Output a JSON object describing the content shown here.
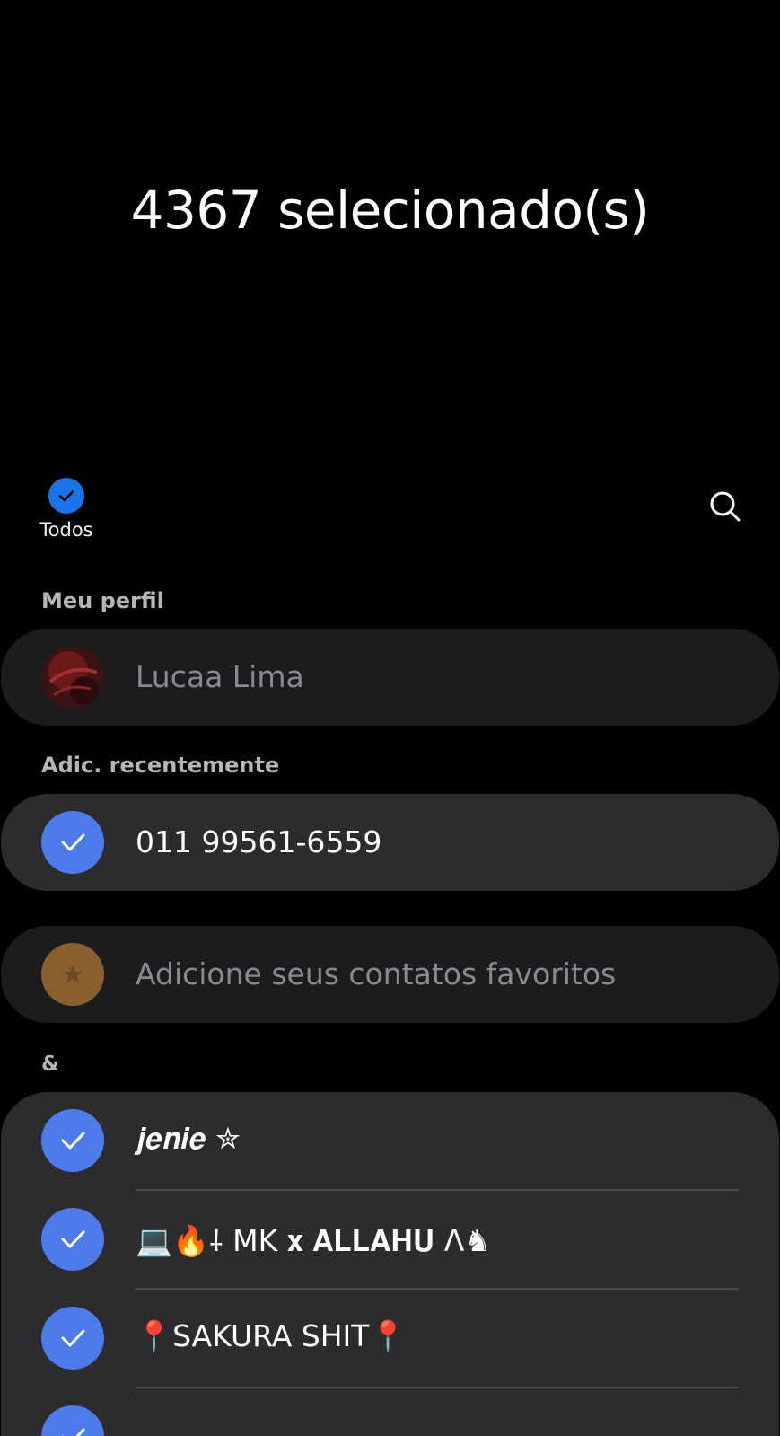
{
  "header": {
    "title": "4367 selecionado(s)"
  },
  "toolbar": {
    "select_all_label": "Todos"
  },
  "sections": {
    "profile_label": "Meu perfil",
    "recent_label": "Adic. recentemente",
    "ampersand_label": "&"
  },
  "profile": {
    "name": "Lucaa Lima"
  },
  "recent": {
    "contact": "011 99561-6559"
  },
  "favorites": {
    "placeholder": "Adicione seus contatos favoritos"
  },
  "contacts": [
    {
      "name": "𝒋𝒆𝒏𝒊𝒆 ✮"
    },
    {
      "name": "💻🔥⸸ MK 𝐱 𝐀𝐋𝐋𝐀𝐇𝐔 ᐱ♞"
    },
    {
      "name": "📍SAKURA SHIT📍"
    }
  ],
  "colors": {
    "accent": "#1a73e8",
    "check_avatar": "#4d7be9",
    "card_bg": "#1c1c1e",
    "selected_card_bg": "#2c2c2e",
    "favorite_avatar": "#8a5f2e"
  }
}
